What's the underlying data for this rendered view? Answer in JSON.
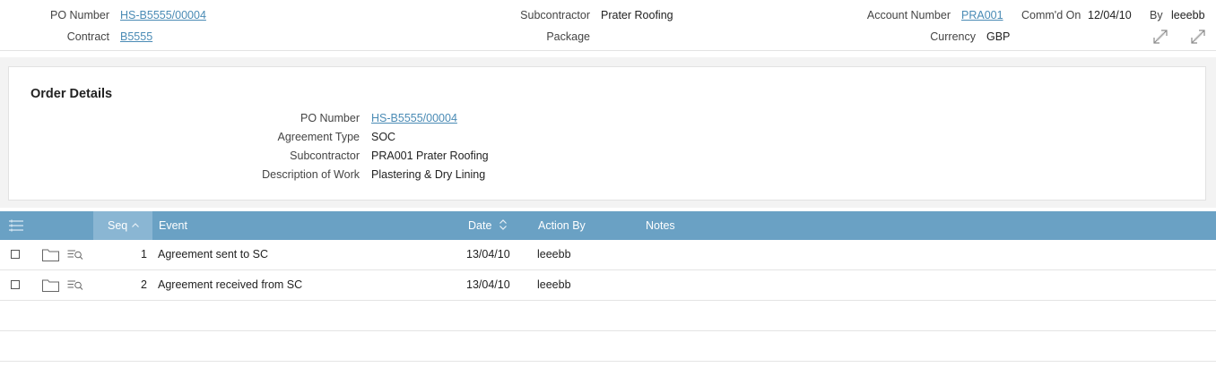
{
  "header": {
    "po_number_label": "PO Number",
    "po_number_value": "HS-B5555/00004",
    "contract_label": "Contract",
    "contract_value": "B5555",
    "subcontractor_label": "Subcontractor",
    "subcontractor_value": "Prater Roofing",
    "package_label": "Package",
    "account_number_label": "Account Number",
    "account_number_value": "PRA001",
    "commd_on_label": "Comm'd On",
    "commd_on_value": "12/04/10",
    "by_label": "By",
    "by_value": "leeebb",
    "currency_label": "Currency",
    "currency_value": "GBP"
  },
  "order_details": {
    "title": "Order Details",
    "fields": [
      {
        "label": "PO Number",
        "value": "HS-B5555/00004",
        "is_link": true
      },
      {
        "label": "Agreement Type",
        "value": "SOC",
        "is_link": false
      },
      {
        "label": "Subcontractor",
        "value": "PRA001 Prater Roofing",
        "is_link": false
      },
      {
        "label": "Description of Work",
        "value": "Plastering & Dry Lining",
        "is_link": false
      }
    ]
  },
  "grid": {
    "columns": {
      "seq": "Seq",
      "event": "Event",
      "date": "Date",
      "action_by": "Action By",
      "notes": "Notes"
    },
    "rows": [
      {
        "seq": "1",
        "event": "Agreement sent to SC",
        "date": "13/04/10",
        "action_by": "leeebb",
        "notes": ""
      },
      {
        "seq": "2",
        "event": "Agreement received from SC",
        "date": "13/04/10",
        "action_by": "leeebb",
        "notes": ""
      }
    ]
  },
  "colors": {
    "header_bar": "#6aa1c4",
    "sorted_column": "#8ab6d3",
    "link": "#4a8bb5"
  }
}
